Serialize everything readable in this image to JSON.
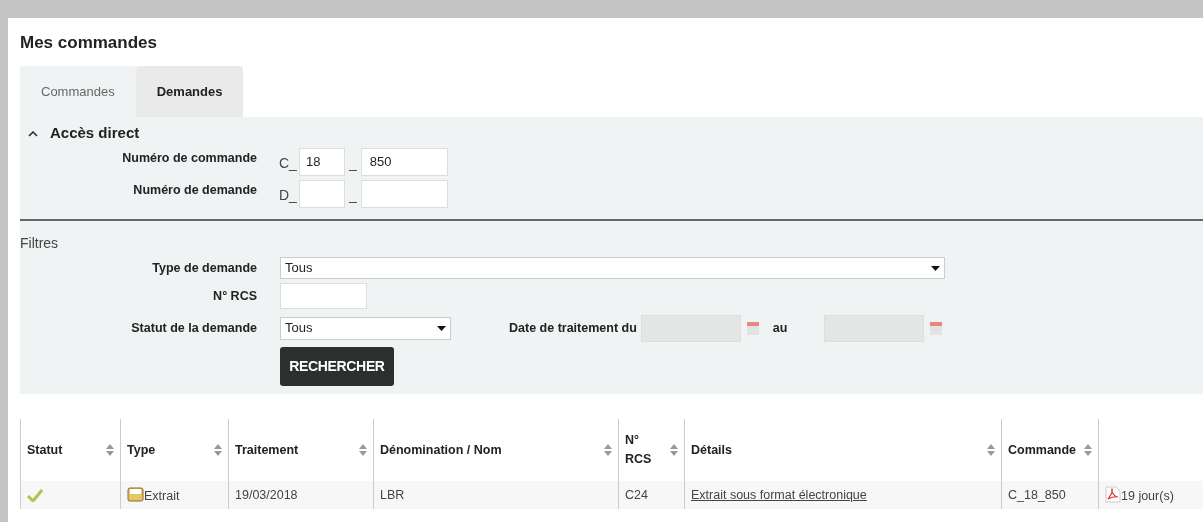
{
  "title": "Mes commandes",
  "tabs": [
    {
      "label": "Commandes",
      "selected": false
    },
    {
      "label": "Demandes",
      "selected": true
    }
  ],
  "direct_access": {
    "title": "Accès direct",
    "expanded": true,
    "fields": [
      {
        "label": "Numéro de commande",
        "prefix": "C_",
        "separator": "_",
        "first_value": "18",
        "second_value": "850"
      },
      {
        "label": "Numéro de demande",
        "prefix": "D_",
        "separator": "_"
      }
    ]
  },
  "filters": {
    "title": "Filtres",
    "type_label": "Type de demande",
    "type_value": "Tous",
    "rcs_label": "N° RCS",
    "status_label": "Statut de la demande",
    "status_value": "Tous",
    "date_label": "Date de traitement du",
    "date_to_label": "au",
    "search_button": "RECHERCHER"
  },
  "table": {
    "columns": [
      {
        "label": "Statut",
        "sortable": true
      },
      {
        "label": "Type",
        "sortable": true
      },
      {
        "label": "Traitement",
        "sortable": true
      },
      {
        "label": "Dénomination / Nom",
        "sortable": true
      },
      {
        "label": "N° RCS",
        "sortable": true
      },
      {
        "label": "Détails",
        "sortable": true
      },
      {
        "label": "Commande",
        "sortable": true
      },
      {
        "sortable": false
      }
    ],
    "rows": [
      {
        "done": true,
        "type": "Extrait",
        "date": "19/03/2018",
        "name": "LBR",
        "rcs": "C24",
        "details": "Extrait sous format électronique",
        "order": "C_18_850",
        "delay": "19 jour(s)"
      }
    ]
  }
}
